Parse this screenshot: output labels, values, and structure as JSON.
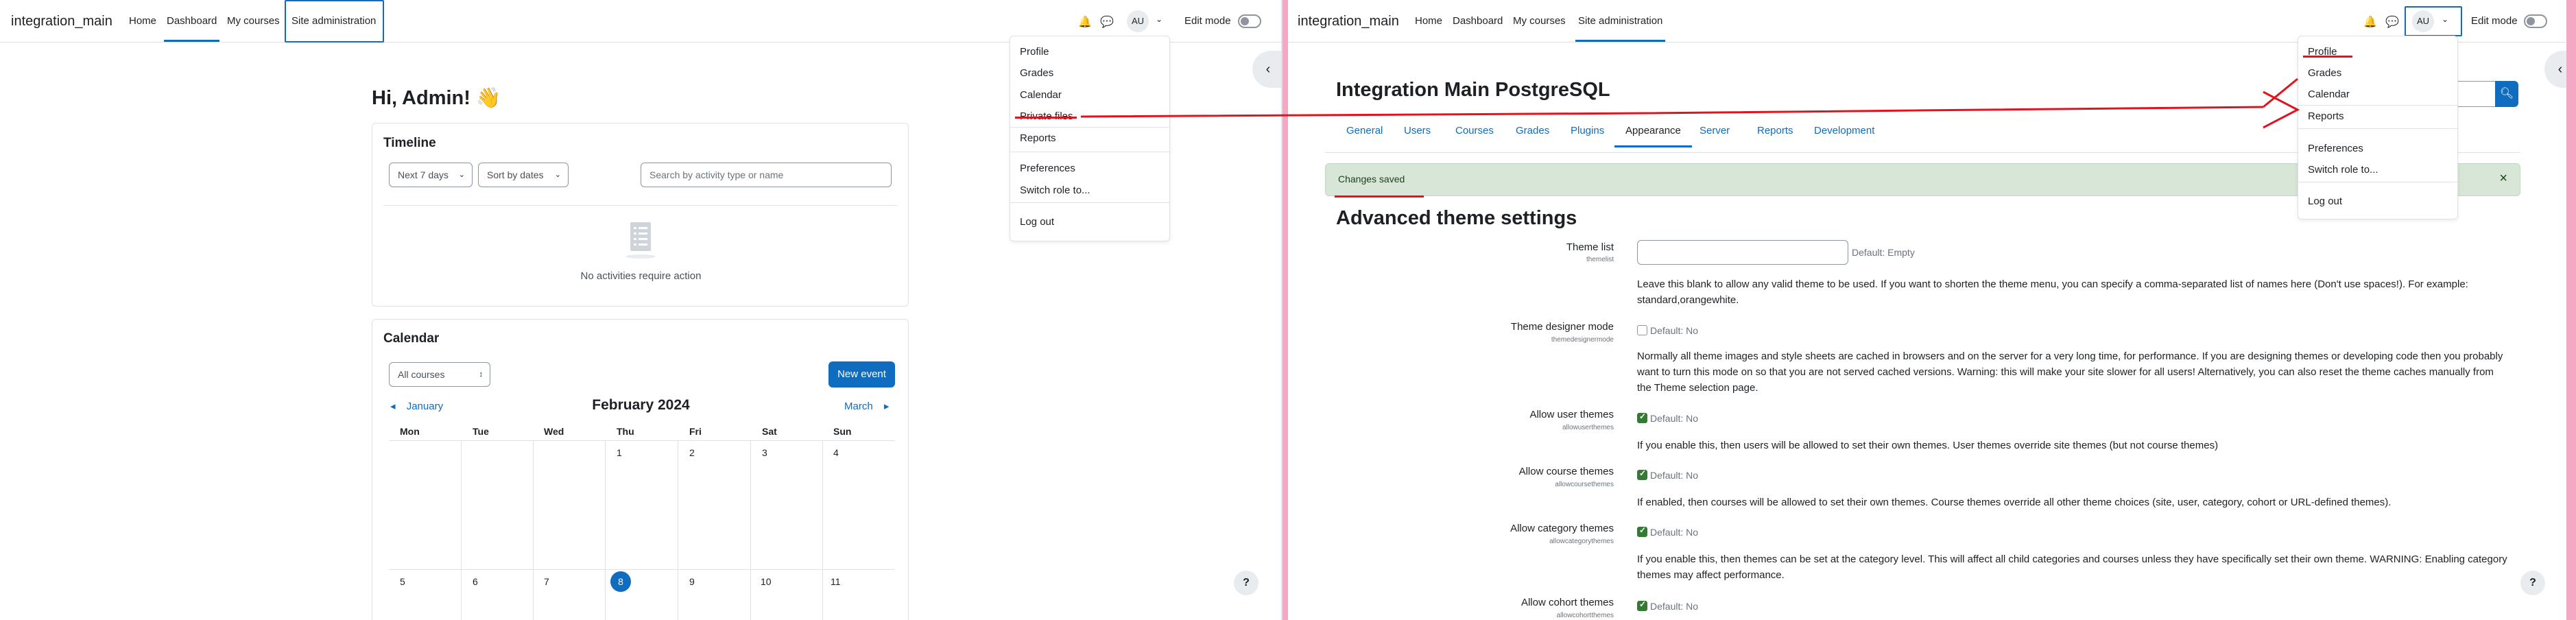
{
  "left": {
    "brand": "integration_main",
    "nav": [
      "Home",
      "Dashboard",
      "My courses",
      "Site administration"
    ],
    "avatar_initials": "AU",
    "edit_mode_label": "Edit mode",
    "greeting": "Hi, Admin! 👋",
    "timeline": {
      "title": "Timeline",
      "filter_days": "Next 7 days",
      "sort": "Sort by dates",
      "search_placeholder": "Search by activity type or name",
      "empty_text": "No activities require action"
    },
    "calendar": {
      "title": "Calendar",
      "course_filter": "All courses",
      "new_event": "New event",
      "prev_month": "January",
      "month": "February 2024",
      "next_month": "March",
      "weekdays": [
        "Mon",
        "Tue",
        "Wed",
        "Thu",
        "Fri",
        "Sat",
        "Sun"
      ],
      "week1": [
        "1",
        "2",
        "3",
        "4"
      ],
      "week2": [
        "5",
        "6",
        "7",
        "8",
        "9",
        "10",
        "11"
      ],
      "today": "8"
    },
    "menu": [
      "Profile",
      "Grades",
      "Calendar",
      "Private files",
      "Reports",
      "Preferences",
      "Switch role to...",
      "Log out"
    ],
    "help": "?"
  },
  "right": {
    "brand": "integration_main",
    "nav": [
      "Home",
      "Dashboard",
      "My courses",
      "Site administration"
    ],
    "avatar_initials": "AU",
    "edit_mode_label": "Edit mode",
    "site_title": "Integration Main PostgreSQL",
    "tabs": [
      "General",
      "Users",
      "Courses",
      "Grades",
      "Plugins",
      "Appearance",
      "Server",
      "Reports",
      "Development"
    ],
    "alert": "Changes saved",
    "heading": "Advanced theme settings",
    "settings": [
      {
        "label": "Theme list",
        "key": "themelist",
        "default": "Default: Empty",
        "desc": "Leave this blank to allow any valid theme to be used. If you want to shorten the theme menu, you can specify a comma-separated list of names here (Don't use spaces!). For example: standard,orangewhite."
      },
      {
        "label": "Theme designer mode",
        "key": "themedesignermode",
        "default": "Default: No",
        "desc": "Normally all theme images and style sheets are cached in browsers and on the server for a very long time, for performance. If you are designing themes or developing code then you probably want to turn this mode on so that you are not served cached versions. Warning: this will make your site slower for all users! Alternatively, you can also reset the theme caches manually from the Theme selection page."
      },
      {
        "label": "Allow user themes",
        "key": "allowuserthemes",
        "default": "Default: No",
        "desc": "If you enable this, then users will be allowed to set their own themes. User themes override site themes (but not course themes)"
      },
      {
        "label": "Allow course themes",
        "key": "allowcoursethemes",
        "default": "Default: No",
        "desc": "If enabled, then courses will be allowed to set their own themes. Course themes override all other theme choices (site, user, category, cohort or URL-defined themes)."
      },
      {
        "label": "Allow category themes",
        "key": "allowcategorythemes",
        "default": "Default: No",
        "desc": "If you enable this, then themes can be set at the category level. This will affect all child categories and courses unless they have specifically set their own theme. WARNING: Enabling category themes may affect performance."
      },
      {
        "label": "Allow cohort themes",
        "key": "allowcohortthemes",
        "default": "Default: No",
        "desc": ""
      }
    ],
    "menu": [
      "Profile",
      "Grades",
      "Calendar",
      "Reports",
      "Preferences",
      "Switch role to...",
      "Log out"
    ],
    "help": "?",
    "close": "×"
  }
}
